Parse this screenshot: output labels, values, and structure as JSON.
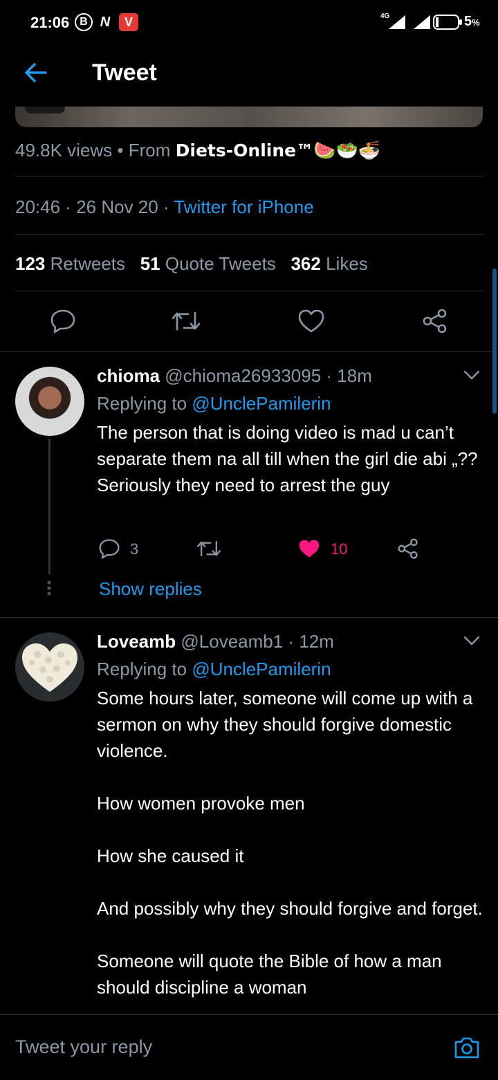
{
  "status_bar": {
    "time": "21:06",
    "b_badge": "B",
    "n_badge": "N",
    "v_badge": "V",
    "network": "4G",
    "battery": "5",
    "battery_unit": "%"
  },
  "header": {
    "title": "Tweet"
  },
  "tweet": {
    "views": "49.8K views",
    "from_label": "From",
    "source_name": "Diets-Online™",
    "source_emoji": "🍉🥗🍜",
    "time": "20:46",
    "date": "26 Nov 20",
    "client": "Twitter for iPhone",
    "retweets_count": "123",
    "retweets_label": "Retweets",
    "quotes_count": "51",
    "quotes_label": "Quote Tweets",
    "likes_count": "362",
    "likes_label": "Likes"
  },
  "replies": [
    {
      "name": "chioma",
      "handle": "@chioma26933095",
      "time": "· 18m",
      "replying_to_label": "Replying to",
      "replying_to": "@UnclePamilerin",
      "text": "The person that is doing video is mad u can’t separate them na all till when the girl die abi „?? Seriously they need to arrest the guy",
      "reply_count": "3",
      "like_count": "10",
      "liked": true,
      "show_replies": "Show replies"
    },
    {
      "name": "Loveamb",
      "handle": "@Loveamb1",
      "time": "· 12m",
      "replying_to_label": "Replying to",
      "replying_to": "@UnclePamilerin",
      "text": "Some hours later, someone will come up with a sermon on why they should forgive domestic violence.\n\nHow women provoke men\n\nHow she caused it\n\nAnd possibly why they should forgive and forget.\n\nSomeone will quote the Bible of how a man should discipline a woman"
    }
  ],
  "reply_bar": {
    "placeholder": "Tweet your reply"
  },
  "colors": {
    "accent": "#1d9bf0",
    "like": "#f91880",
    "background": "#000000",
    "secondary_text": "#8b98a5"
  }
}
